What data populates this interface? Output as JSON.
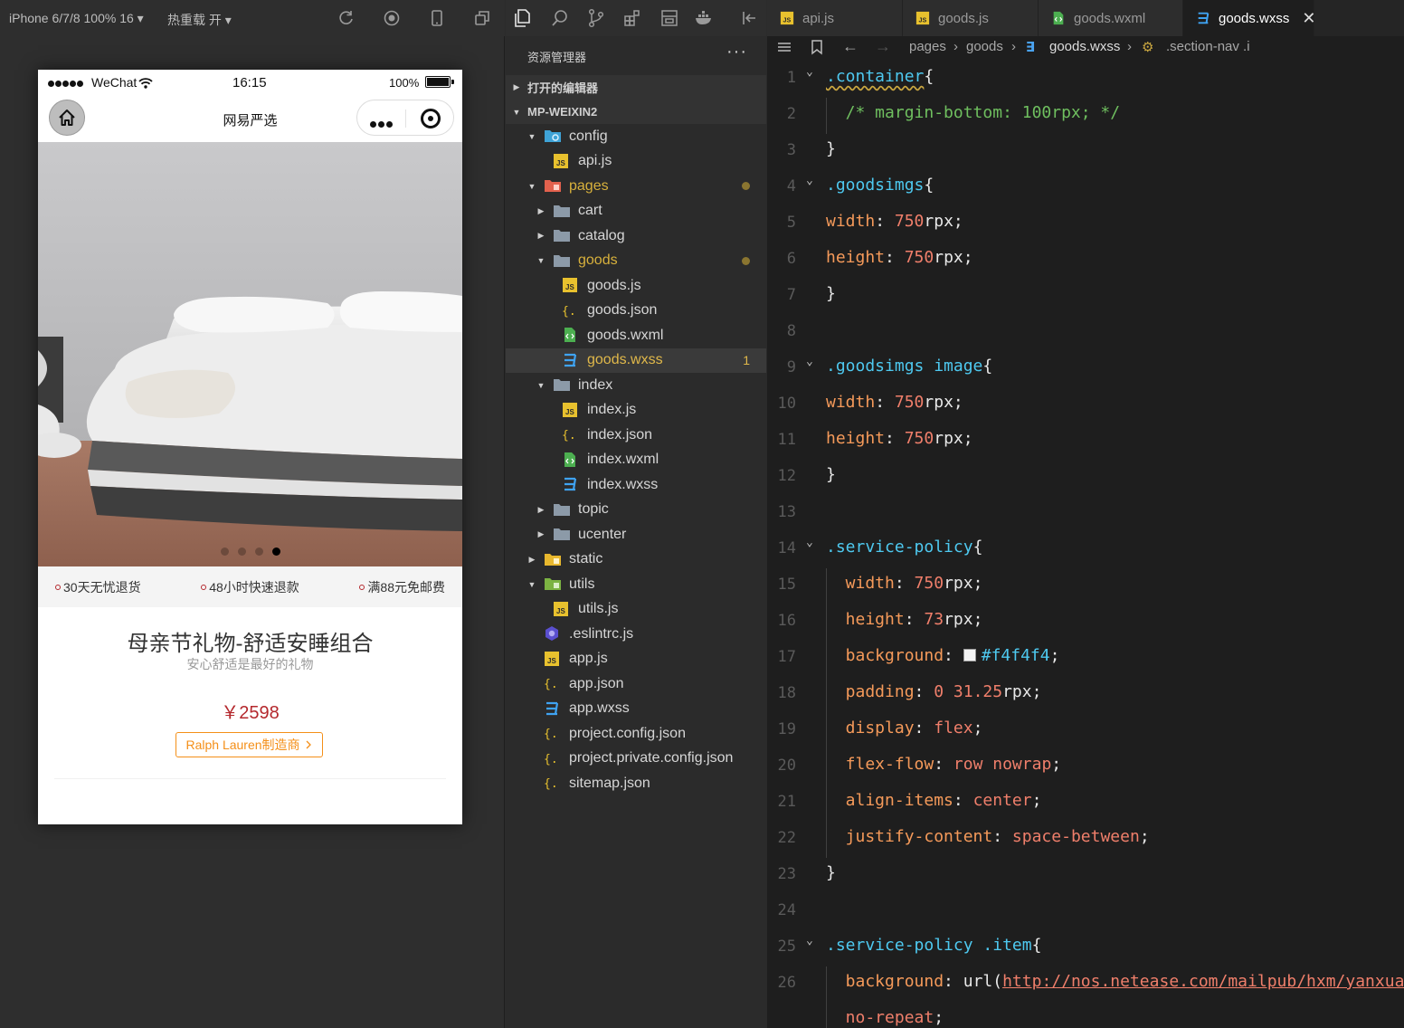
{
  "simulator": {
    "device_label": "iPhone 6/7/8 100% 16 ▾",
    "hot_reload_label": "热重载 开 ▾",
    "status_bar": {
      "carrier": "WeChat",
      "time": "16:15",
      "battery": "100%"
    },
    "nav_title": "网易严选",
    "policy": [
      "30天无忧退货",
      "48小时快速退款",
      "满88元免邮费"
    ],
    "goods": {
      "name": "母亲节礼物-舒适安睡组合",
      "brief": "安心舒适是最好的礼物",
      "price": "￥2598",
      "brand_button": "Ralph Lauren制造商"
    },
    "swiper": {
      "count": 4,
      "active_index": 3
    }
  },
  "explorer": {
    "header": "资源管理器",
    "more": "···",
    "section_open_editors": "打开的编辑器",
    "section_project": "MP-WEIXIN2",
    "tree": [
      {
        "name": "config",
        "type": "folder-config",
        "open": true,
        "depth": 0
      },
      {
        "name": "api.js",
        "type": "js",
        "depth": 1
      },
      {
        "name": "pages",
        "type": "folder-pages",
        "open": true,
        "depth": 0,
        "modified": true
      },
      {
        "name": "cart",
        "type": "folder",
        "open": false,
        "depth": 1
      },
      {
        "name": "catalog",
        "type": "folder",
        "open": false,
        "depth": 1
      },
      {
        "name": "goods",
        "type": "folder",
        "open": true,
        "depth": 1,
        "modified": true
      },
      {
        "name": "goods.js",
        "type": "js",
        "depth": 2
      },
      {
        "name": "goods.json",
        "type": "json",
        "depth": 2
      },
      {
        "name": "goods.wxml",
        "type": "wxml",
        "depth": 2
      },
      {
        "name": "goods.wxss",
        "type": "wxss",
        "depth": 2,
        "selected": true,
        "badge": "1"
      },
      {
        "name": "index",
        "type": "folder",
        "open": true,
        "depth": 1
      },
      {
        "name": "index.js",
        "type": "js",
        "depth": 2
      },
      {
        "name": "index.json",
        "type": "json",
        "depth": 2
      },
      {
        "name": "index.wxml",
        "type": "wxml",
        "depth": 2
      },
      {
        "name": "index.wxss",
        "type": "wxss",
        "depth": 2
      },
      {
        "name": "topic",
        "type": "folder",
        "open": false,
        "depth": 1
      },
      {
        "name": "ucenter",
        "type": "folder",
        "open": false,
        "depth": 1
      },
      {
        "name": "static",
        "type": "folder-static",
        "open": false,
        "depth": 0
      },
      {
        "name": "utils",
        "type": "folder-utils",
        "open": true,
        "depth": 0
      },
      {
        "name": "utils.js",
        "type": "js",
        "depth": 1
      },
      {
        "name": ".eslintrc.js",
        "type": "eslint",
        "depth": 0
      },
      {
        "name": "app.js",
        "type": "js",
        "depth": 0
      },
      {
        "name": "app.json",
        "type": "json",
        "depth": 0
      },
      {
        "name": "app.wxss",
        "type": "wxss",
        "depth": 0
      },
      {
        "name": "project.config.json",
        "type": "json",
        "depth": 0
      },
      {
        "name": "project.private.config.json",
        "type": "json",
        "depth": 0
      },
      {
        "name": "sitemap.json",
        "type": "json",
        "depth": 0
      }
    ]
  },
  "editor": {
    "tabs": [
      {
        "name": "api.js",
        "type": "js",
        "active": false
      },
      {
        "name": "goods.js",
        "type": "js",
        "active": false
      },
      {
        "name": "goods.wxml",
        "type": "wxml",
        "active": false
      },
      {
        "name": "goods.wxss",
        "type": "wxss",
        "active": true
      }
    ],
    "breadcrumb": [
      "pages",
      "goods",
      "goods.wxss",
      ".section-nav .i"
    ],
    "lines": [
      {
        "n": "1",
        "fold": true,
        "tokens": [
          [
            "sel-c squig",
            ".container"
          ],
          [
            "brace",
            "{"
          ]
        ]
      },
      {
        "n": "2",
        "indent": true,
        "tokens": [
          [
            "cmt",
            "  /* margin-bottom: 100rpx; */"
          ]
        ]
      },
      {
        "n": "3",
        "tokens": [
          [
            "brace",
            "}"
          ]
        ]
      },
      {
        "n": "4",
        "fold": true,
        "tokens": [
          [
            "sel-c",
            ".goodsimgs"
          ],
          [
            "brace",
            "{"
          ]
        ]
      },
      {
        "n": "5",
        "tokens": [
          [
            "prop",
            "width"
          ],
          [
            "punc",
            ": "
          ],
          [
            "num",
            "750"
          ],
          [
            "unit",
            "rpx;"
          ]
        ]
      },
      {
        "n": "6",
        "tokens": [
          [
            "prop",
            "height"
          ],
          [
            "punc",
            ": "
          ],
          [
            "num",
            "750"
          ],
          [
            "unit",
            "rpx;"
          ]
        ]
      },
      {
        "n": "7",
        "tokens": [
          [
            "brace",
            "}"
          ]
        ]
      },
      {
        "n": "8",
        "tokens": []
      },
      {
        "n": "9",
        "fold": true,
        "tokens": [
          [
            "sel-c",
            ".goodsimgs image"
          ],
          [
            "brace",
            "{"
          ]
        ]
      },
      {
        "n": "10",
        "tokens": [
          [
            "prop",
            "width"
          ],
          [
            "punc",
            ": "
          ],
          [
            "num",
            "750"
          ],
          [
            "unit",
            "rpx;"
          ]
        ]
      },
      {
        "n": "11",
        "tokens": [
          [
            "prop",
            "height"
          ],
          [
            "punc",
            ": "
          ],
          [
            "num",
            "750"
          ],
          [
            "unit",
            "rpx;"
          ]
        ]
      },
      {
        "n": "12",
        "tokens": [
          [
            "brace",
            "}"
          ]
        ]
      },
      {
        "n": "13",
        "tokens": []
      },
      {
        "n": "14",
        "fold": true,
        "tokens": [
          [
            "sel-c",
            ".service-policy"
          ],
          [
            "brace",
            "{"
          ]
        ]
      },
      {
        "n": "15",
        "indent": true,
        "tokens": [
          [
            "prop",
            "  width"
          ],
          [
            "punc",
            ": "
          ],
          [
            "num",
            "750"
          ],
          [
            "unit",
            "rpx;"
          ]
        ]
      },
      {
        "n": "16",
        "indent": true,
        "tokens": [
          [
            "prop",
            "  height"
          ],
          [
            "punc",
            ": "
          ],
          [
            "num",
            "73"
          ],
          [
            "unit",
            "rpx;"
          ]
        ]
      },
      {
        "n": "17",
        "indent": true,
        "tokens": [
          [
            "prop",
            "  background"
          ],
          [
            "punc",
            ": "
          ],
          [
            "swatch",
            ""
          ],
          [
            "hash",
            "#f4f4f4"
          ],
          [
            "punc",
            ";"
          ]
        ]
      },
      {
        "n": "18",
        "indent": true,
        "tokens": [
          [
            "prop",
            "  padding"
          ],
          [
            "punc",
            ": "
          ],
          [
            "num",
            "0 31.25"
          ],
          [
            "unit",
            "rpx;"
          ]
        ]
      },
      {
        "n": "19",
        "indent": true,
        "tokens": [
          [
            "prop",
            "  display"
          ],
          [
            "punc",
            ": "
          ],
          [
            "val",
            "flex"
          ],
          [
            "punc",
            ";"
          ]
        ]
      },
      {
        "n": "20",
        "indent": true,
        "tokens": [
          [
            "prop",
            "  flex-flow"
          ],
          [
            "punc",
            ": "
          ],
          [
            "val",
            "row nowrap"
          ],
          [
            "punc",
            ";"
          ]
        ]
      },
      {
        "n": "21",
        "indent": true,
        "tokens": [
          [
            "prop",
            "  align-items"
          ],
          [
            "punc",
            ": "
          ],
          [
            "val",
            "center"
          ],
          [
            "punc",
            ";"
          ]
        ]
      },
      {
        "n": "22",
        "indent": true,
        "tokens": [
          [
            "prop",
            "  justify-content"
          ],
          [
            "punc",
            ": "
          ],
          [
            "val",
            "space-between"
          ],
          [
            "punc",
            ";"
          ]
        ]
      },
      {
        "n": "23",
        "tokens": [
          [
            "brace",
            "}"
          ]
        ]
      },
      {
        "n": "24",
        "tokens": []
      },
      {
        "n": "25",
        "fold": true,
        "tokens": [
          [
            "sel-c",
            ".service-policy .item"
          ],
          [
            "brace",
            "{"
          ]
        ]
      },
      {
        "n": "26",
        "indent": true,
        "tokens": [
          [
            "prop",
            "  background"
          ],
          [
            "punc",
            ": "
          ],
          [
            "unit",
            "url("
          ],
          [
            "url",
            "http://nos.netease.com/mailpub/hxm/yanxuan"
          ]
        ]
      },
      {
        "n": "",
        "indent": true,
        "tokens": [
          [
            "val",
            "  no-repeat"
          ],
          [
            "punc",
            ";"
          ]
        ]
      }
    ]
  },
  "colors": {
    "accent_red": "#b4282d",
    "accent_orange": "#f48f18",
    "policy_bg": "#f4f4f4",
    "editor_bg": "#1e1e1e"
  }
}
